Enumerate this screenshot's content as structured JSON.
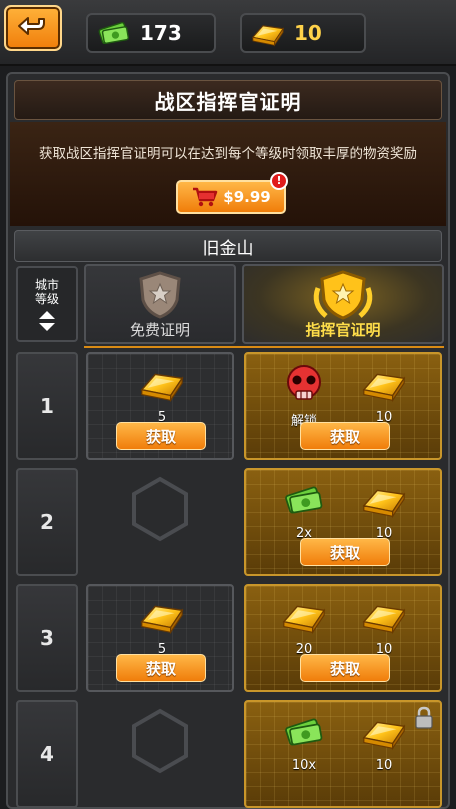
{
  "topbar": {
    "cash": "173",
    "gold": "10"
  },
  "panel": {
    "title": "战区指挥官证明",
    "description": "获取战区指挥官证明可以在达到每个等级时领取丰厚的物资奖励",
    "price": "$9.99",
    "alert": "!",
    "city": "旧金山"
  },
  "columns": {
    "level_header_line1": "城市",
    "level_header_line2": "等级",
    "free": "免费证明",
    "commander": "指挥官证明"
  },
  "get_label": "获取",
  "rows": [
    {
      "level": "1",
      "free_qty": "5",
      "cmd_a_qty": "解锁",
      "cmd_b_qty": "10"
    },
    {
      "level": "2",
      "cmd_a_qty": "2x",
      "cmd_b_qty": "10"
    },
    {
      "level": "3",
      "free_qty": "5",
      "cmd_a_qty": "20",
      "cmd_b_qty": "10"
    },
    {
      "level": "4",
      "cmd_a_qty": "10x",
      "cmd_b_qty": "10"
    }
  ],
  "colors": {
    "accent_orange": "#f07d0a",
    "gold_text": "#ffde4a",
    "alert_red": "#e01c1c"
  }
}
